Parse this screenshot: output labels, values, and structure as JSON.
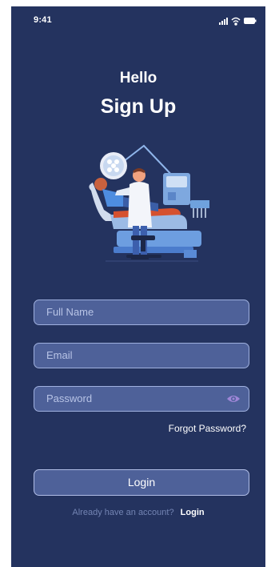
{
  "status_bar": {
    "time": "9:41",
    "icons": [
      "signal-icon",
      "wifi-icon",
      "battery-icon"
    ]
  },
  "header": {
    "greeting": "Hello",
    "title": "Sign Up"
  },
  "illustration": {
    "icon": "dentist-illustration"
  },
  "form": {
    "full_name_placeholder": "Full Name",
    "email_placeholder": "Email",
    "password_placeholder": "Password",
    "forgot_password": "Forgot Password?",
    "login_button": "Login"
  },
  "footer": {
    "account_prompt": "Already have an account?",
    "login_link": "Login"
  },
  "colors": {
    "background": "#24335f",
    "field": "#4e6199",
    "accent": "#9f86d8"
  }
}
